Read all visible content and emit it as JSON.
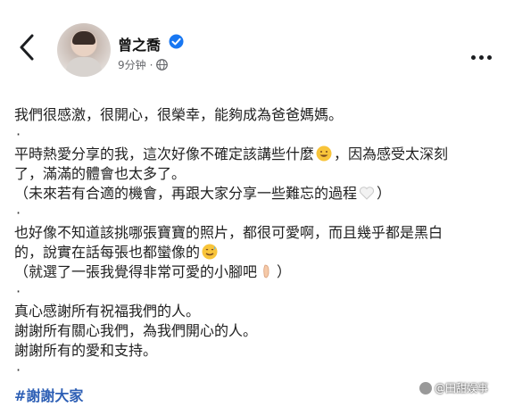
{
  "header": {
    "name": "曾之喬",
    "time": "9分钟",
    "privacy_icon": "globe-icon",
    "back_icon": "chevron-left-icon",
    "more_icon": "more-horizontal-icon"
  },
  "post": {
    "lines": [
      "我們很感激，很開心，很榮幸，能夠成為爸爸媽媽。",
      "平時熱愛分享的我，這次好像不確定該講些什麼",
      "，因為感受太深刻",
      "了，滿滿的體會也太多了。",
      "（未來若有合適的機會，再跟大家分享一些難忘的過程",
      "）",
      "也好像不知道該挑哪張寶寶的照片，都很可愛啊，而且幾乎都是黑白",
      "的，說實在話每張也都蠻像的",
      "（就選了一張我覺得非常可愛的小腳吧",
      "）",
      "真心感謝所有祝福我們的人。",
      "謝謝所有關心我們，為我們開心的人。",
      "謝謝所有的愛和支持。"
    ],
    "separator": "·",
    "hashtag": "#謝謝大家"
  },
  "watermark": "@田甜娱事",
  "colors": {
    "verified": "#1877f2",
    "hashtag": "#2d5fb5",
    "meta": "#65676b"
  }
}
